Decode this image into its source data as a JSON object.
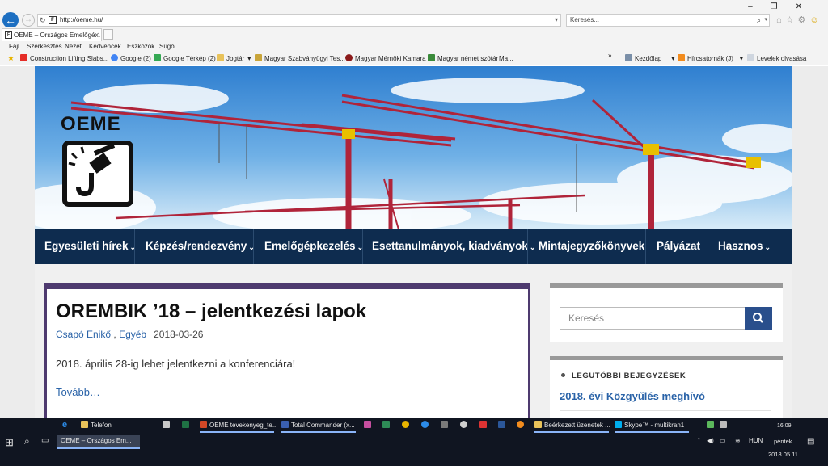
{
  "browser": {
    "url": "http://oeme.hu/",
    "search_placeholder": "Keresés...",
    "tab_title": "OEME – Országos Emelőgé...",
    "menu": [
      "Fájl",
      "Szerkesztés",
      "Nézet",
      "Kedvencek",
      "Eszközök",
      "Súgó"
    ],
    "favorites": [
      {
        "label": "Construction Lifting Slabs...",
        "icon": "youtube-icon",
        "color": "#e52d27"
      },
      {
        "label": "Google (2)",
        "icon": "google-icon",
        "color": "#4285f4"
      },
      {
        "label": "Google Térkép (2)",
        "icon": "maps-icon",
        "color": "#34a853"
      },
      {
        "label": "Jogtár",
        "icon": "folder-icon",
        "color": "#e8c25a"
      },
      {
        "label": "Magyar Szabványügyi Tes...",
        "icon": "msz-icon",
        "color": "#c9a53a"
      },
      {
        "label": "Magyar Mérnöki Kamara",
        "icon": "mmk-icon",
        "color": "#8b1a1a"
      },
      {
        "label": "Magyar német szótár",
        "icon": "dict-icon",
        "color": "#3a8a3a"
      },
      {
        "label": "Ma...",
        "icon": "page-icon",
        "color": "#888888"
      }
    ],
    "favorites_right": [
      {
        "label": "Kezdőlap",
        "icon": "home-icon"
      },
      {
        "label": "Hírcsatornák (J)",
        "icon": "rss-icon"
      },
      {
        "label": "Levelek olvasása",
        "icon": "mail-icon"
      }
    ]
  },
  "site": {
    "logo_text": "OEME",
    "nav": [
      "Egyesületi hírek",
      "Képzés/rendezvény",
      "Emelőgépkezelés",
      "Esettanulmányok, kiadványok",
      "Mintajegyzőkönyvek",
      "Pályázat",
      "Hasznos"
    ],
    "nav_dropdown": [
      true,
      true,
      true,
      true,
      false,
      false,
      true
    ],
    "post": {
      "title": "OREMBIK ’18 – jelentkezési lapok",
      "author": "Csapó Enikő",
      "category": "Egyéb",
      "date": "2018-03-26",
      "excerpt": "2018. április 28-ig lehet jelentkezni a konferenciára!",
      "more": "Tovább…"
    },
    "sidebar": {
      "search_placeholder": "Keresés",
      "recent_heading": "LEGUTÓBBI BEJEGYZÉSEK",
      "recent_posts": [
        "2018. évi Közgyűlés meghívó"
      ]
    }
  },
  "taskbar": {
    "top_items": [
      {
        "label": "",
        "icon": "edge-icon"
      },
      {
        "label": "Telefon",
        "icon": "folder-icon"
      },
      {
        "label": "",
        "icon": "store-icon"
      },
      {
        "label": "",
        "icon": "excel-icon"
      },
      {
        "label": "OEME tevekenyeg_te...",
        "icon": "powerpoint-icon"
      },
      {
        "label": "Total Commander (x...",
        "icon": "totalcommander-icon"
      },
      {
        "label": "Beérkezett üzenetek ...",
        "icon": "outlook-icon"
      },
      {
        "label": "Skype™ - multikran1",
        "icon": "skype-icon"
      }
    ],
    "active_window": "OEME – Országos Em...",
    "tray": {
      "language": "HUN",
      "time": "16:09",
      "day": "péntek",
      "date": "2018.05.11."
    }
  }
}
